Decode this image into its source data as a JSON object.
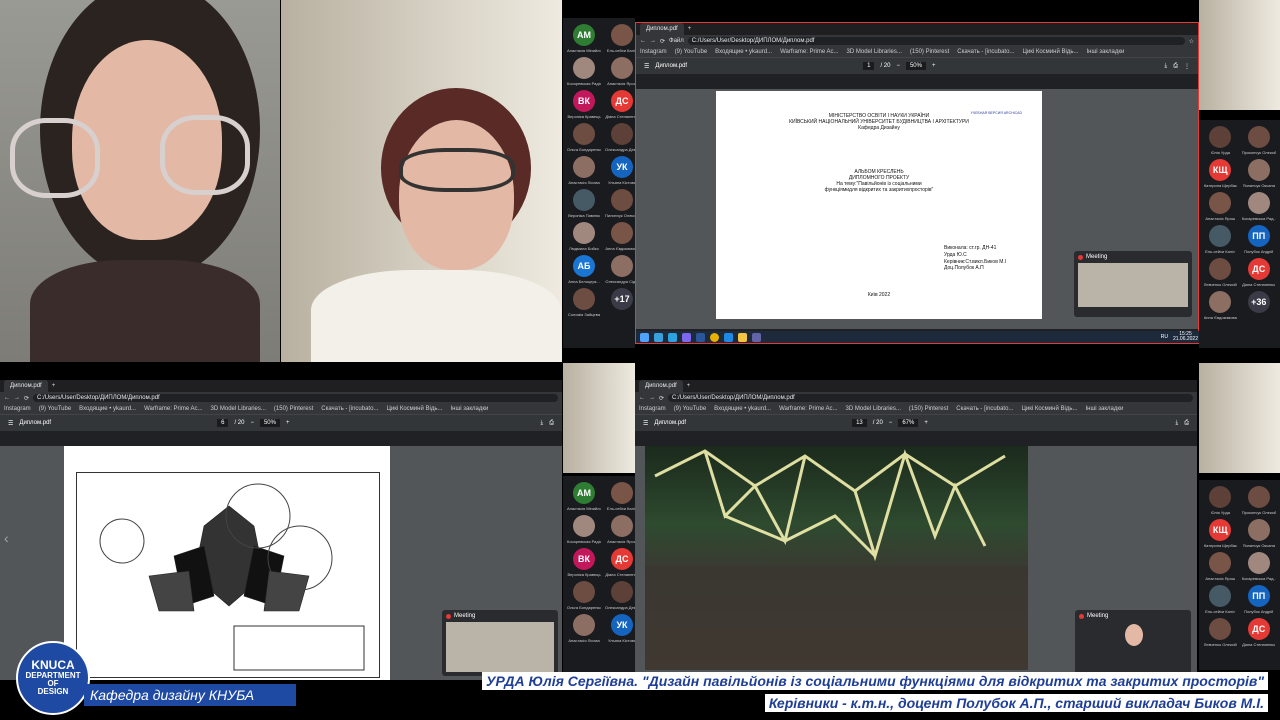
{
  "browser": {
    "tab_title": "Диплом.pdf",
    "url_label": "Файл",
    "url": "C:/Users/User/Desktop/ДИПЛОМ/Диплом.pdf",
    "bookmarks": [
      "Instagram",
      "(9) YouTube",
      "Входящие • ykaurd...",
      "Warframe: Prime Ac...",
      "3D Model Libraries...",
      "(150) Pinterest",
      "Скачать - [incubato...",
      "Цикі Косминй Відь...",
      "Інші закладки"
    ],
    "file_title": "Диплом.pdf"
  },
  "pdf_top": {
    "page": "1",
    "total": "/ 20",
    "zoom": "50%",
    "ministry": "МІНІСТЕРСТВО ОСВІТИ І НАУКИ УКРАЇНИ",
    "university": "КИЇВСЬКИЙ НАЦІОНАЛЬНИЙ УНІВЕРСИТЕТ БУДІВНИЦТВА І АРХІТЕКТУРИ",
    "department": "Кафедра Дизайну",
    "stamp": "УЧЕБНАЯ ВЕРСИЯ ARCHICAD",
    "album": "АЛЬБОМ КРЕСЛЕНЬ",
    "project": "ДИПЛОМНОГО ПРОЕКТУ",
    "theme1": "На тему:\"Павільйонів із соціальними",
    "theme2": "функціямидля відкритих та закритихпросторів\"",
    "done1": "Виконала: ст.гр. ДН-41",
    "done2": "Урда Ю.С",
    "done3": "Керівник:Ст.викл.Биков М.І",
    "done4": "Доц.Полубок А.П",
    "city": "Київ 2022"
  },
  "pdf_left": {
    "page": "6",
    "total": "/ 20",
    "zoom": "50%"
  },
  "pdf_right": {
    "page": "13",
    "total": "/ 20",
    "zoom": "67%"
  },
  "taskbar": {
    "lang": "RU",
    "time": "15:25",
    "date": "21.06.2022"
  },
  "meeting_label": "Meeting",
  "participants_top": [
    {
      "initials": "АМ",
      "name": "Анастасія Міняйло",
      "color": "#2e7d32"
    },
    {
      "initials": "",
      "name": "Ель-сейхи Каліл",
      "color": "#795548"
    },
    {
      "initials": "",
      "name": "Косаревская Радіо...",
      "color": "#a1887f"
    },
    {
      "initials": "",
      "name": "Анастасія Ярош",
      "color": "#8d6e63"
    },
    {
      "initials": "ВК",
      "name": "Вероніка Кравець",
      "color": "#c2185b"
    },
    {
      "initials": "ДС",
      "name": "Діана Степаненко",
      "color": "#e53935"
    },
    {
      "initials": "",
      "name": "Ольга Бондаренко",
      "color": "#6d4c41"
    },
    {
      "initials": "",
      "name": "Олександра Дем...",
      "color": "#5d4037"
    },
    {
      "initials": "",
      "name": "Анастасія Лісова",
      "color": "#8d6e63"
    },
    {
      "initials": "УК",
      "name": "Ульяна Кістова",
      "color": "#1565c0"
    },
    {
      "initials": "",
      "name": "Вероніка Павлюк",
      "color": "#455a64"
    },
    {
      "initials": "",
      "name": "Пилипчук Олександр",
      "color": "#6d4c41"
    },
    {
      "initials": "",
      "name": "Людмила Бойко",
      "color": "#a1887f"
    },
    {
      "initials": "",
      "name": "Анна Євдокимова",
      "color": "#795548"
    },
    {
      "initials": "АБ",
      "name": "Анна Белоцерк...",
      "color": "#1976d2"
    },
    {
      "initials": "",
      "name": "Олександра Сід...",
      "color": "#8d6e63"
    },
    {
      "initials": "",
      "name": "Соломія Зайцева",
      "color": "#6d4c41"
    },
    {
      "initials": "+17",
      "name": "",
      "color": "#3a3b46"
    }
  ],
  "participants_right": [
    {
      "initials": "",
      "name": "Юлія Урда",
      "color": "#5d4037"
    },
    {
      "initials": "",
      "name": "Прокопчук Олексій",
      "color": "#6d4c41"
    },
    {
      "initials": "КЩ",
      "name": "Катерина Щербак",
      "color": "#e53935"
    },
    {
      "initials": "",
      "name": "Пилипчук Оксана",
      "color": "#8d6e63"
    },
    {
      "initials": "",
      "name": "Анастасія Ярош",
      "color": "#795548"
    },
    {
      "initials": "",
      "name": "Косаревська Рад...",
      "color": "#a1887f"
    },
    {
      "initials": "",
      "name": "Ель-сейхи Каліл",
      "color": "#455a64"
    },
    {
      "initials": "ПП",
      "name": "Полубок Андрій",
      "color": "#1565c0"
    },
    {
      "initials": "",
      "name": "Левченко Олексій",
      "color": "#6d4c41"
    },
    {
      "initials": "ДС",
      "name": "Діана Степаненко",
      "color": "#e53935"
    },
    {
      "initials": "",
      "name": "Анна Євдокимова",
      "color": "#8d6e63"
    },
    {
      "initials": "+36",
      "name": "",
      "color": "#3a3b46"
    }
  ],
  "logo": {
    "line1": "KNUCA",
    "line2": "DEPARTMENT",
    "line3": "OF",
    "line4": "DESIGN"
  },
  "department_caption": "Кафедра дизайну КНУБА",
  "caption_line1": "УРДА Юлія Сергіївна. \"Дизайн павільйонів із соціальними функціями для відкритих та закритих просторів\"",
  "caption_line2": "Керівники - к.т.н., доцент Полубок А.П., старший викладач Биков М.І.",
  "colors": {
    "accent": "#1f4aa3",
    "caption_text": "#1f3f96",
    "highlight_border": "#e53935"
  }
}
